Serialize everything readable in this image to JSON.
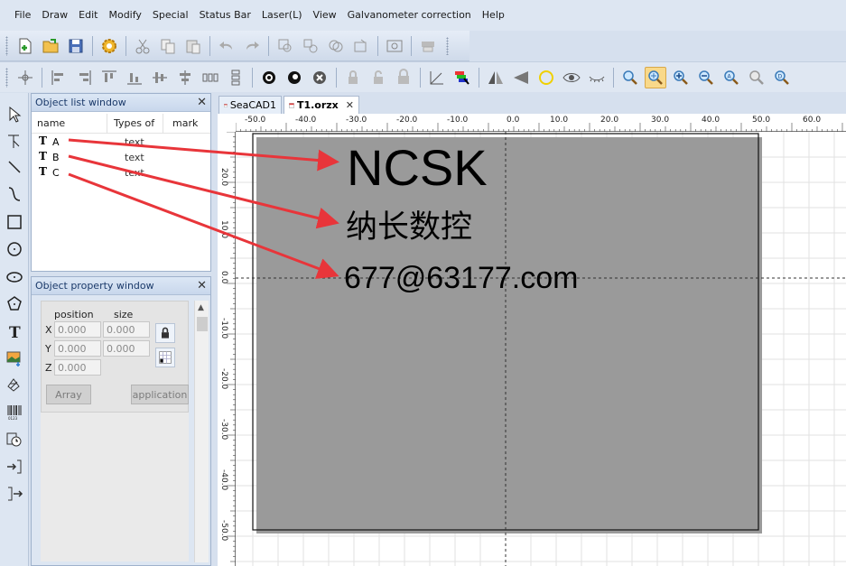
{
  "menu": [
    "File",
    "Draw",
    "Edit",
    "Modify",
    "Special",
    "Status Bar",
    "Laser(L)",
    "View",
    "Galvanometer correction",
    "Help"
  ],
  "object_list": {
    "title": "Object list window",
    "close": "✕",
    "columns": [
      "name",
      "Types of",
      "mark"
    ],
    "rows": [
      {
        "icon": "T",
        "name": "A",
        "type": "text"
      },
      {
        "icon": "T",
        "name": "B",
        "type": "text"
      },
      {
        "icon": "T",
        "name": "C",
        "type": "text"
      }
    ]
  },
  "object_property": {
    "title": "Object property window",
    "close": "✕",
    "position_label": "position",
    "size_label": "size",
    "x_label": "X",
    "y_label": "Y",
    "z_label": "Z",
    "x_value": "0.000",
    "y_value": "0.000",
    "z_value": "0.000",
    "w_value": "0.000",
    "h_value": "0.000",
    "array_label": "Array",
    "apply_label": "application"
  },
  "tabs": [
    {
      "label": "SeaCAD1",
      "active": false
    },
    {
      "label": "T1.orzx",
      "active": true,
      "close": "✕"
    }
  ],
  "ruler_h": [
    "-50.0",
    "-40.0",
    "-30.0",
    "-20.0",
    "-10.0",
    "0.0",
    "10.0",
    "20.0",
    "30.0",
    "40.0",
    "50.0",
    "60.0"
  ],
  "ruler_v": [
    "20.0",
    "10.0",
    "0.0",
    "-10.0",
    "-20.0",
    "-30.0",
    "-40.0",
    "-50.0"
  ],
  "canvas_texts": {
    "a": "NCSK",
    "b": "纳长数控",
    "c": "677@63177.com"
  },
  "colors": {
    "arrow": "#e8353a",
    "accent_tab": "#f9d98a"
  }
}
